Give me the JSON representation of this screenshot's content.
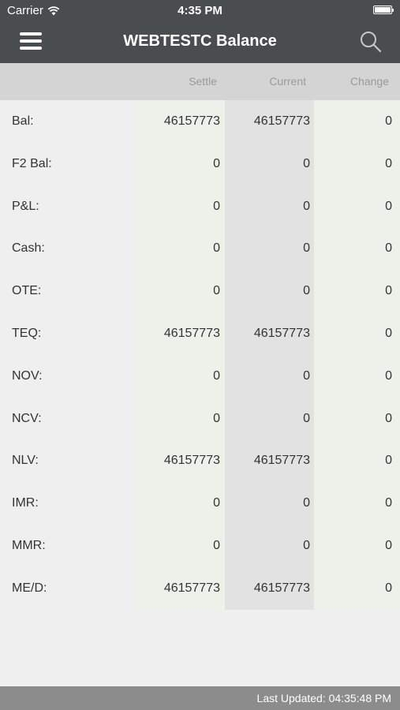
{
  "status_bar": {
    "carrier": "Carrier",
    "time": "4:35 PM"
  },
  "nav": {
    "title": "WEBTESTC Balance",
    "menu_icon": "hamburger-menu-icon",
    "search_icon": "search-icon"
  },
  "columns": {
    "settle": "Settle",
    "current": "Current",
    "change": "Change"
  },
  "rows": [
    {
      "label": "Bal:",
      "settle": "46157773",
      "current": "46157773",
      "change": "0"
    },
    {
      "label": "F2 Bal:",
      "settle": "0",
      "current": "0",
      "change": "0"
    },
    {
      "label": "P&L:",
      "settle": "0",
      "current": "0",
      "change": "0"
    },
    {
      "label": "Cash:",
      "settle": "0",
      "current": "0",
      "change": "0"
    },
    {
      "label": "OTE:",
      "settle": "0",
      "current": "0",
      "change": "0"
    },
    {
      "label": "TEQ:",
      "settle": "46157773",
      "current": "46157773",
      "change": "0"
    },
    {
      "label": "NOV:",
      "settle": "0",
      "current": "0",
      "change": "0"
    },
    {
      "label": "NCV:",
      "settle": "0",
      "current": "0",
      "change": "0"
    },
    {
      "label": "NLV:",
      "settle": "46157773",
      "current": "46157773",
      "change": "0"
    },
    {
      "label": "IMR:",
      "settle": "0",
      "current": "0",
      "change": "0"
    },
    {
      "label": "MMR:",
      "settle": "0",
      "current": "0",
      "change": "0"
    },
    {
      "label": "ME/D:",
      "settle": "46157773",
      "current": "46157773",
      "change": "0"
    }
  ],
  "footer": {
    "last_updated": "Last Updated: 04:35:48 PM"
  },
  "colors": {
    "header_bg": "#4a4d4d",
    "settle_col": "#eef1e9",
    "current_col": "#e2e2e2",
    "footer_bg": "#8c8c8c"
  }
}
